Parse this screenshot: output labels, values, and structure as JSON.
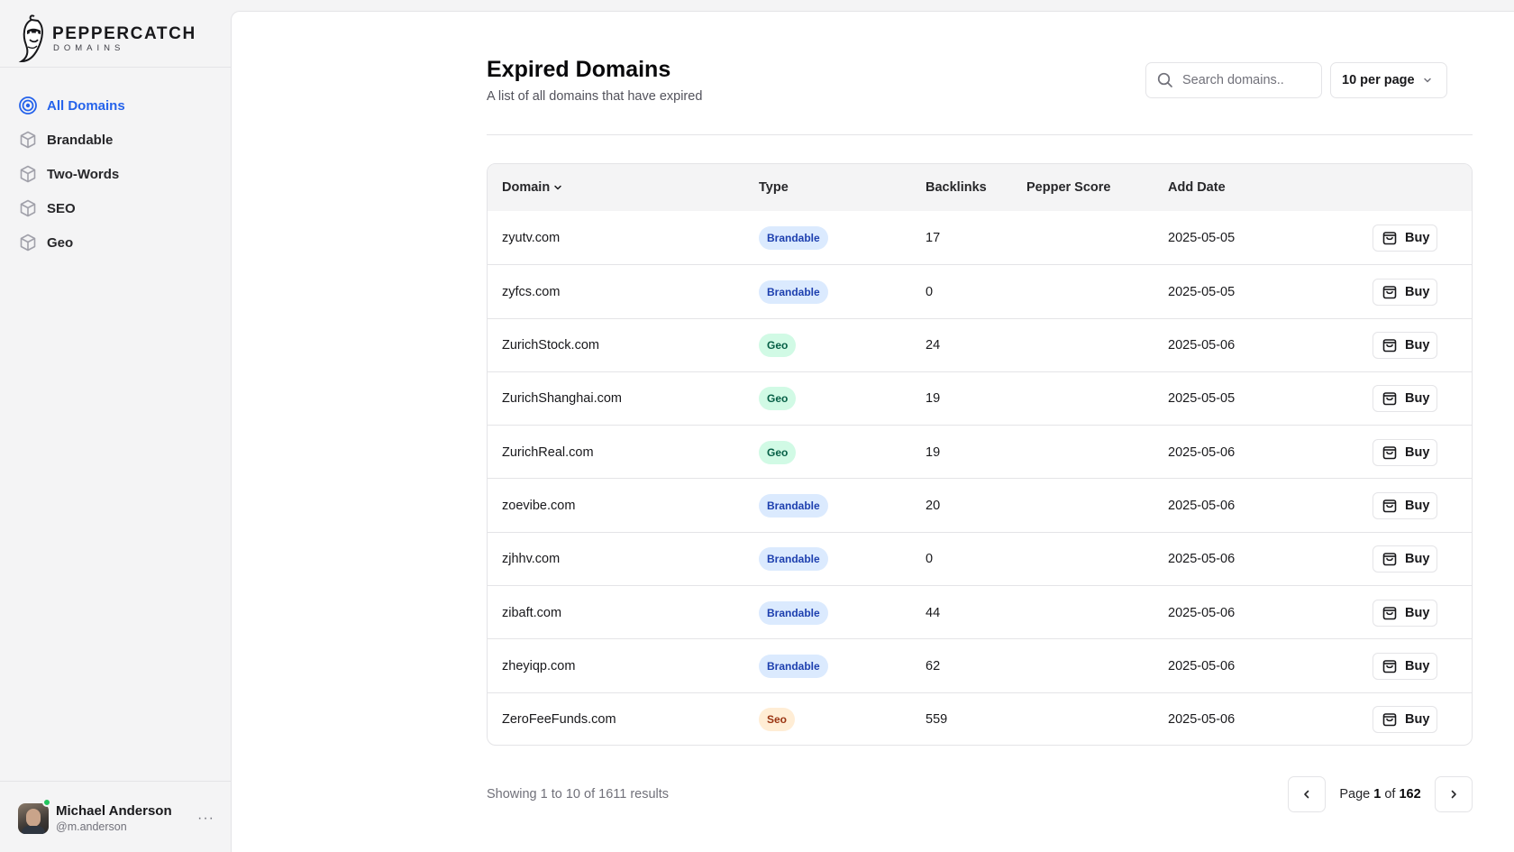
{
  "brand": {
    "name": "PEPPERCATCH",
    "tagline": "DOMAINS"
  },
  "sidebar": {
    "items": [
      {
        "label": "All Domains",
        "icon": "target-icon",
        "active": true
      },
      {
        "label": "Brandable",
        "icon": "cube-icon",
        "active": false
      },
      {
        "label": "Two-Words",
        "icon": "cube-icon",
        "active": false
      },
      {
        "label": "SEO",
        "icon": "cube-icon",
        "active": false
      },
      {
        "label": "Geo",
        "icon": "cube-icon",
        "active": false
      }
    ]
  },
  "user": {
    "name": "Michael Anderson",
    "handle": "@m.anderson",
    "more": "···",
    "status": "online"
  },
  "page": {
    "title": "Expired Domains",
    "subtitle": "A list of all domains that have expired"
  },
  "search": {
    "placeholder": "Search domains..",
    "value": ""
  },
  "per_page": {
    "selected": "10 per page"
  },
  "table": {
    "headers": {
      "domain": "Domain",
      "type": "Type",
      "backlinks": "Backlinks",
      "pepper_score": "Pepper Score",
      "add_date": "Add Date"
    },
    "buy_label": "Buy",
    "rows": [
      {
        "domain": "zyutv.com",
        "type": "Brandable",
        "backlinks": "17",
        "pepper_score": "",
        "add_date": "2025-05-05"
      },
      {
        "domain": "zyfcs.com",
        "type": "Brandable",
        "backlinks": "0",
        "pepper_score": "",
        "add_date": "2025-05-05"
      },
      {
        "domain": "ZurichStock.com",
        "type": "Geo",
        "backlinks": "24",
        "pepper_score": "",
        "add_date": "2025-05-06"
      },
      {
        "domain": "ZurichShanghai.com",
        "type": "Geo",
        "backlinks": "19",
        "pepper_score": "",
        "add_date": "2025-05-05"
      },
      {
        "domain": "ZurichReal.com",
        "type": "Geo",
        "backlinks": "19",
        "pepper_score": "",
        "add_date": "2025-05-06"
      },
      {
        "domain": "zoevibe.com",
        "type": "Brandable",
        "backlinks": "20",
        "pepper_score": "",
        "add_date": "2025-05-06"
      },
      {
        "domain": "zjhhv.com",
        "type": "Brandable",
        "backlinks": "0",
        "pepper_score": "",
        "add_date": "2025-05-06"
      },
      {
        "domain": "zibaft.com",
        "type": "Brandable",
        "backlinks": "44",
        "pepper_score": "",
        "add_date": "2025-05-06"
      },
      {
        "domain": "zheyiqp.com",
        "type": "Brandable",
        "backlinks": "62",
        "pepper_score": "",
        "add_date": "2025-05-06"
      },
      {
        "domain": "ZeroFeeFunds.com",
        "type": "Seo",
        "backlinks": "559",
        "pepper_score": "",
        "add_date": "2025-05-06"
      }
    ]
  },
  "footer": {
    "results_text": "Showing 1 to 10 of 1611 results",
    "page_prefix": "Page",
    "current_page": "1",
    "of_label": "of",
    "total_pages": "162"
  },
  "colors": {
    "accent": "#2563eb",
    "brandable_bg": "#dbeafe",
    "geo_bg": "#d1fae5",
    "seo_bg": "#ffedd5",
    "online": "#22c55e"
  }
}
